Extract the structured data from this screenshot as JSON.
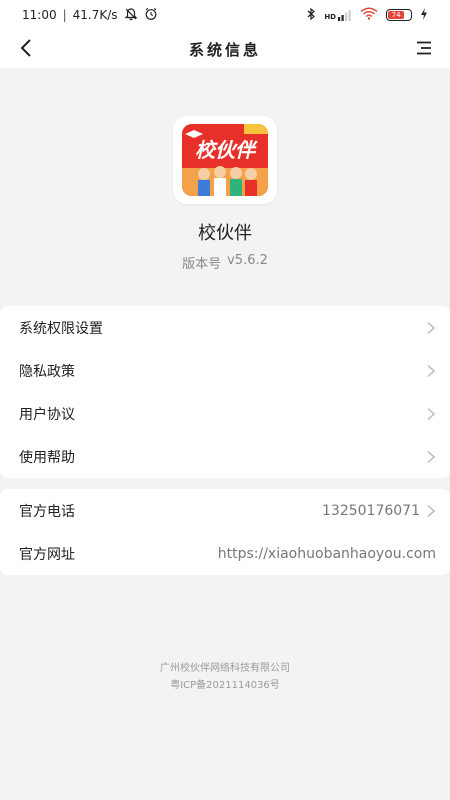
{
  "status_bar": {
    "time": "11:00",
    "network_speed": "41.7K/s",
    "icons": [
      "mute-bell-icon",
      "alarm-icon",
      "bluetooth-icon",
      "hd-signal-icon",
      "wifi-icon",
      "battery-icon",
      "charging-icon"
    ],
    "hd_label": "HD",
    "battery_level": "74"
  },
  "nav": {
    "title": "系统信息",
    "back_icon": "back-arrow-icon",
    "menu_icon": "menu-icon"
  },
  "app": {
    "icon_text": "校伙伴",
    "name": "校伙伴",
    "version_label": "版本号",
    "version_value": "v5.6.2"
  },
  "settings": {
    "items": [
      {
        "label": "系统权限设置"
      },
      {
        "label": "隐私政策"
      },
      {
        "label": "用户协议"
      },
      {
        "label": "使用帮助"
      }
    ]
  },
  "contact": {
    "phone_label": "官方电话",
    "phone_value": "13250176071",
    "website_label": "官方网址",
    "website_value": "https://xiaohuobanhaoyou.com"
  },
  "footer": {
    "company": "广州校伙伴网络科技有限公司",
    "icp": "粤ICP备2021114036号"
  },
  "colors": {
    "brand_red": "#e8302b",
    "background": "#f3f3f3",
    "card": "#ffffff",
    "battery_fill": "#e2463a"
  }
}
